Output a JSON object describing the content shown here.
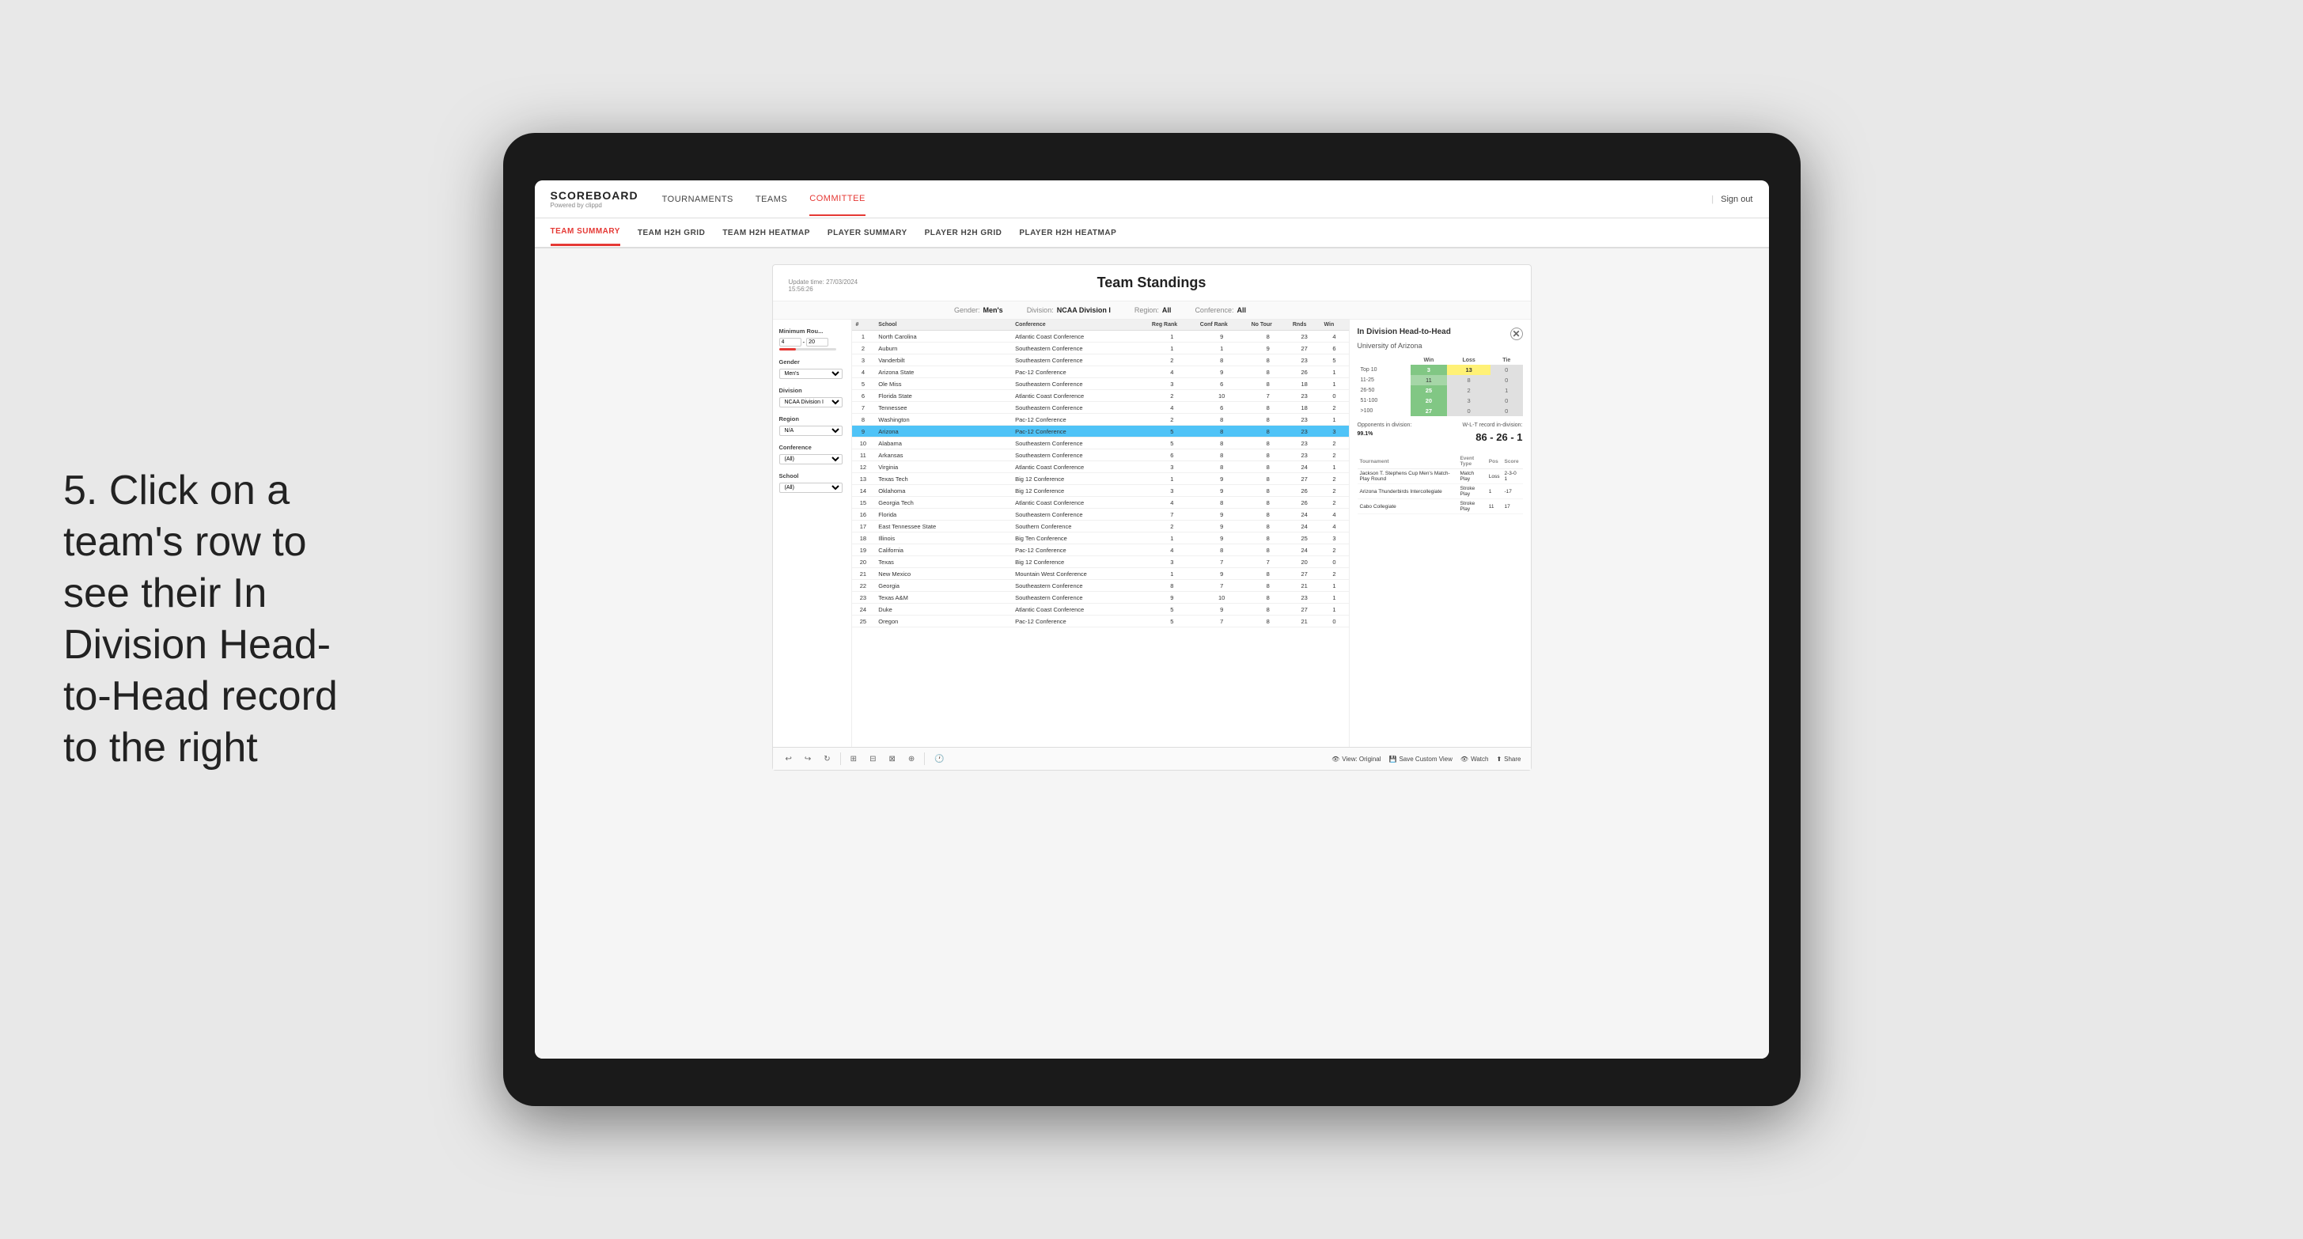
{
  "annotation": {
    "text": "5. Click on a team's row to see their In Division Head-to-Head record to the right"
  },
  "nav": {
    "logo": "SCOREBOARD",
    "logo_sub": "Powered by clippd",
    "links": [
      "TOURNAMENTS",
      "TEAMS",
      "COMMITTEE"
    ],
    "active_link": "COMMITTEE",
    "sign_out": "Sign out"
  },
  "sub_nav": {
    "links": [
      "TEAM SUMMARY",
      "TEAM H2H GRID",
      "TEAM H2H HEATMAP",
      "PLAYER SUMMARY",
      "PLAYER H2H GRID",
      "PLAYER H2H HEATMAP"
    ],
    "active": "TEAM SUMMARY"
  },
  "scoreboard": {
    "title": "Team Standings",
    "update_time": "Update time: 27/03/2024 15:56:26",
    "filters": {
      "gender": "Men's",
      "division": "NCAA Division I",
      "region": "All",
      "conference": "All"
    },
    "left_filters": {
      "minimum_rounds": {
        "label": "Minimum Rou...",
        "val1": "4",
        "val2": "20"
      },
      "gender": {
        "label": "Gender",
        "value": "Men's"
      },
      "division": {
        "label": "Division",
        "value": "NCAA Division I"
      },
      "region": {
        "label": "Region",
        "value": "N/A"
      },
      "conference": {
        "label": "Conference",
        "value": "(All)"
      },
      "school": {
        "label": "School",
        "value": "(All)"
      }
    },
    "table": {
      "headers": [
        "#",
        "School",
        "Conference",
        "Reg Rank",
        "Conf Rank",
        "No Tour",
        "Rnds",
        "Win"
      ],
      "rows": [
        {
          "rank": 1,
          "school": "North Carolina",
          "conference": "Atlantic Coast Conference",
          "reg": 1,
          "conf": 9,
          "no_tour": 8,
          "rnds": 23,
          "win": 4
        },
        {
          "rank": 2,
          "school": "Auburn",
          "conference": "Southeastern Conference",
          "reg": 1,
          "conf": 1,
          "no_tour": 9,
          "rnds": 27,
          "win": 6
        },
        {
          "rank": 3,
          "school": "Vanderbilt",
          "conference": "Southeastern Conference",
          "reg": 2,
          "conf": 8,
          "no_tour": 8,
          "rnds": 23,
          "win": 5
        },
        {
          "rank": 4,
          "school": "Arizona State",
          "conference": "Pac-12 Conference",
          "reg": 4,
          "conf": 9,
          "no_tour": 8,
          "rnds": 26,
          "win": 1
        },
        {
          "rank": 5,
          "school": "Ole Miss",
          "conference": "Southeastern Conference",
          "reg": 3,
          "conf": 6,
          "no_tour": 8,
          "rnds": 18,
          "win": 1
        },
        {
          "rank": 6,
          "school": "Florida State",
          "conference": "Atlantic Coast Conference",
          "reg": 2,
          "conf": 10,
          "no_tour": 7,
          "rnds": 23,
          "win": 0
        },
        {
          "rank": 7,
          "school": "Tennessee",
          "conference": "Southeastern Conference",
          "reg": 4,
          "conf": 6,
          "no_tour": 8,
          "rnds": 18,
          "win": 2
        },
        {
          "rank": 8,
          "school": "Washington",
          "conference": "Pac-12 Conference",
          "reg": 2,
          "conf": 8,
          "no_tour": 8,
          "rnds": 23,
          "win": 1
        },
        {
          "rank": 9,
          "school": "Arizona",
          "conference": "Pac-12 Conference",
          "reg": 5,
          "conf": 8,
          "no_tour": 8,
          "rnds": 23,
          "win": 3,
          "highlighted": true
        },
        {
          "rank": 10,
          "school": "Alabama",
          "conference": "Southeastern Conference",
          "reg": 5,
          "conf": 8,
          "no_tour": 8,
          "rnds": 23,
          "win": 2
        },
        {
          "rank": 11,
          "school": "Arkansas",
          "conference": "Southeastern Conference",
          "reg": 6,
          "conf": 8,
          "no_tour": 8,
          "rnds": 23,
          "win": 2
        },
        {
          "rank": 12,
          "school": "Virginia",
          "conference": "Atlantic Coast Conference",
          "reg": 3,
          "conf": 8,
          "no_tour": 8,
          "rnds": 24,
          "win": 1
        },
        {
          "rank": 13,
          "school": "Texas Tech",
          "conference": "Big 12 Conference",
          "reg": 1,
          "conf": 9,
          "no_tour": 8,
          "rnds": 27,
          "win": 2
        },
        {
          "rank": 14,
          "school": "Oklahoma",
          "conference": "Big 12 Conference",
          "reg": 3,
          "conf": 9,
          "no_tour": 8,
          "rnds": 26,
          "win": 2
        },
        {
          "rank": 15,
          "school": "Georgia Tech",
          "conference": "Atlantic Coast Conference",
          "reg": 4,
          "conf": 8,
          "no_tour": 8,
          "rnds": 26,
          "win": 2
        },
        {
          "rank": 16,
          "school": "Florida",
          "conference": "Southeastern Conference",
          "reg": 7,
          "conf": 9,
          "no_tour": 8,
          "rnds": 24,
          "win": 4
        },
        {
          "rank": 17,
          "school": "East Tennessee State",
          "conference": "Southern Conference",
          "reg": 2,
          "conf": 9,
          "no_tour": 8,
          "rnds": 24,
          "win": 4
        },
        {
          "rank": 18,
          "school": "Illinois",
          "conference": "Big Ten Conference",
          "reg": 1,
          "conf": 9,
          "no_tour": 8,
          "rnds": 25,
          "win": 3
        },
        {
          "rank": 19,
          "school": "California",
          "conference": "Pac-12 Conference",
          "reg": 4,
          "conf": 8,
          "no_tour": 8,
          "rnds": 24,
          "win": 2
        },
        {
          "rank": 20,
          "school": "Texas",
          "conference": "Big 12 Conference",
          "reg": 3,
          "conf": 7,
          "no_tour": 7,
          "rnds": 20,
          "win": 0
        },
        {
          "rank": 21,
          "school": "New Mexico",
          "conference": "Mountain West Conference",
          "reg": 1,
          "conf": 9,
          "no_tour": 8,
          "rnds": 27,
          "win": 2
        },
        {
          "rank": 22,
          "school": "Georgia",
          "conference": "Southeastern Conference",
          "reg": 8,
          "conf": 7,
          "no_tour": 8,
          "rnds": 21,
          "win": 1
        },
        {
          "rank": 23,
          "school": "Texas A&M",
          "conference": "Southeastern Conference",
          "reg": 9,
          "conf": 10,
          "no_tour": 8,
          "rnds": 23,
          "win": 1
        },
        {
          "rank": 24,
          "school": "Duke",
          "conference": "Atlantic Coast Conference",
          "reg": 5,
          "conf": 9,
          "no_tour": 8,
          "rnds": 27,
          "win": 1
        },
        {
          "rank": 25,
          "school": "Oregon",
          "conference": "Pac-12 Conference",
          "reg": 5,
          "conf": 7,
          "no_tour": 8,
          "rnds": 21,
          "win": 0
        }
      ]
    },
    "h2h": {
      "title": "In Division Head-to-Head",
      "school": "University of Arizona",
      "categories": [
        "Win",
        "Loss",
        "Tie"
      ],
      "rows": [
        {
          "label": "Top 10",
          "win": 3,
          "loss": 13,
          "tie": 0,
          "win_class": "cell-green",
          "loss_class": "cell-yellow"
        },
        {
          "label": "11-25",
          "win": 11,
          "loss": 8,
          "tie": 0,
          "win_class": "cell-light-green",
          "loss_class": "cell-zero"
        },
        {
          "label": "26-50",
          "win": 25,
          "loss": 2,
          "tie": 1,
          "win_class": "cell-green",
          "loss_class": "cell-zero"
        },
        {
          "label": "51-100",
          "win": 20,
          "loss": 3,
          "tie": 0,
          "win_class": "cell-green",
          "loss_class": "cell-zero"
        },
        {
          "label": ">100",
          "win": 27,
          "loss": 0,
          "tie": 0,
          "win_class": "cell-green",
          "loss_class": "cell-zero"
        }
      ],
      "opponents_pct": "99.1%",
      "wlt_record": "86 - 26 - 1",
      "tournaments": [
        {
          "name": "Jackson T. Stephens Cup Men's Match-Play Round",
          "type": "Match Play",
          "pos": "Loss",
          "score": "2-3-0 1"
        },
        {
          "name": "Arizona Thunderbirds Intercollegiate",
          "type": "Stroke Play",
          "pos": "1",
          "score": "-17"
        },
        {
          "name": "Cabo Collegiate",
          "type": "Stroke Play",
          "pos": "11",
          "score": "17"
        }
      ]
    },
    "toolbar": {
      "actions": [
        "↩",
        "↩",
        "↩",
        "⊡",
        "⊡",
        "⊡",
        "⊕",
        "🕐"
      ],
      "view_original": "View: Original",
      "save_custom": "Save Custom View",
      "watch": "Watch",
      "share": "Share"
    }
  }
}
